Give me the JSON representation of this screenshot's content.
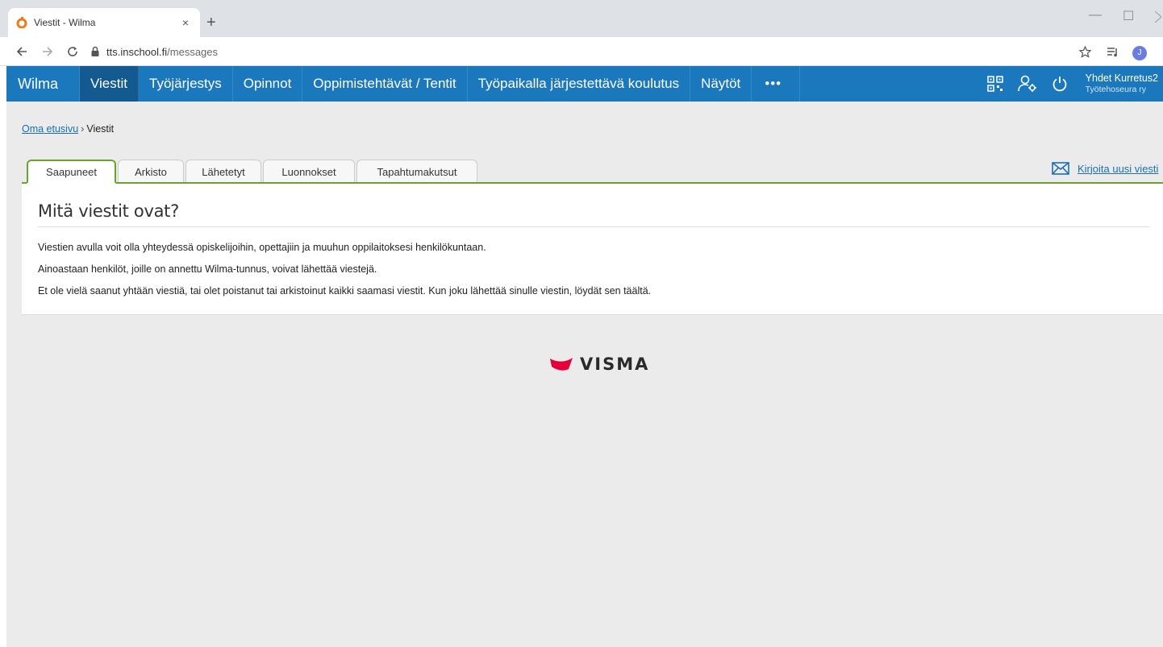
{
  "browser": {
    "tab_title": "Viestit - Wilma",
    "tab_close": "×",
    "new_tab": "+",
    "url_domain": "tts.inschool.fi",
    "url_path": "/messages",
    "profile_initial": "J",
    "win_minimize": "—",
    "win_maximize": "☐"
  },
  "navbar": {
    "brand": "Wilma",
    "items": [
      "Viestit",
      "Työjärjestys",
      "Opinnot",
      "Oppimistehtävät / Tentit",
      "Työpaikalla järjestettävä koulutus",
      "Näytöt"
    ],
    "more": "•••",
    "user_name": "Yhdet Kurretus2",
    "user_org": "Työtehoseura ry",
    "icons": [
      "qr-code-icon",
      "user-settings-icon",
      "power-icon"
    ]
  },
  "breadcrumb": {
    "home": "Oma etusivu",
    "separator": "›",
    "current": "Viestit"
  },
  "tabs": [
    "Saapuneet",
    "Arkisto",
    "Lähetetyt",
    "Luonnokset",
    "Tapahtumakutsut"
  ],
  "write_new": "Kirjoita uusi viesti",
  "panel": {
    "heading": "Mitä viestit ovat?",
    "lines": [
      "Viestien avulla voit olla yhteydessä opiskelijoihin, opettajiin ja muuhun oppilaitoksesi henkilökuntaan.",
      "Ainoastaan henkilöt, joille on annettu Wilma-tunnus, voivat lähettää viestejä.",
      "Et ole vielä saanut yhtään viestiä, tai olet poistanut tai arkistoinut kaikki saamasi viestit. Kun joku lähettää sinulle viestin, löydät sen täältä."
    ]
  },
  "footer": {
    "logo_text": "VISMA"
  },
  "colors": {
    "nav": "#1b78bd",
    "nav_active": "#125a8f",
    "tab_green": "#6aa329",
    "link": "#1a6fb5",
    "visma_red": "#e4003a"
  }
}
